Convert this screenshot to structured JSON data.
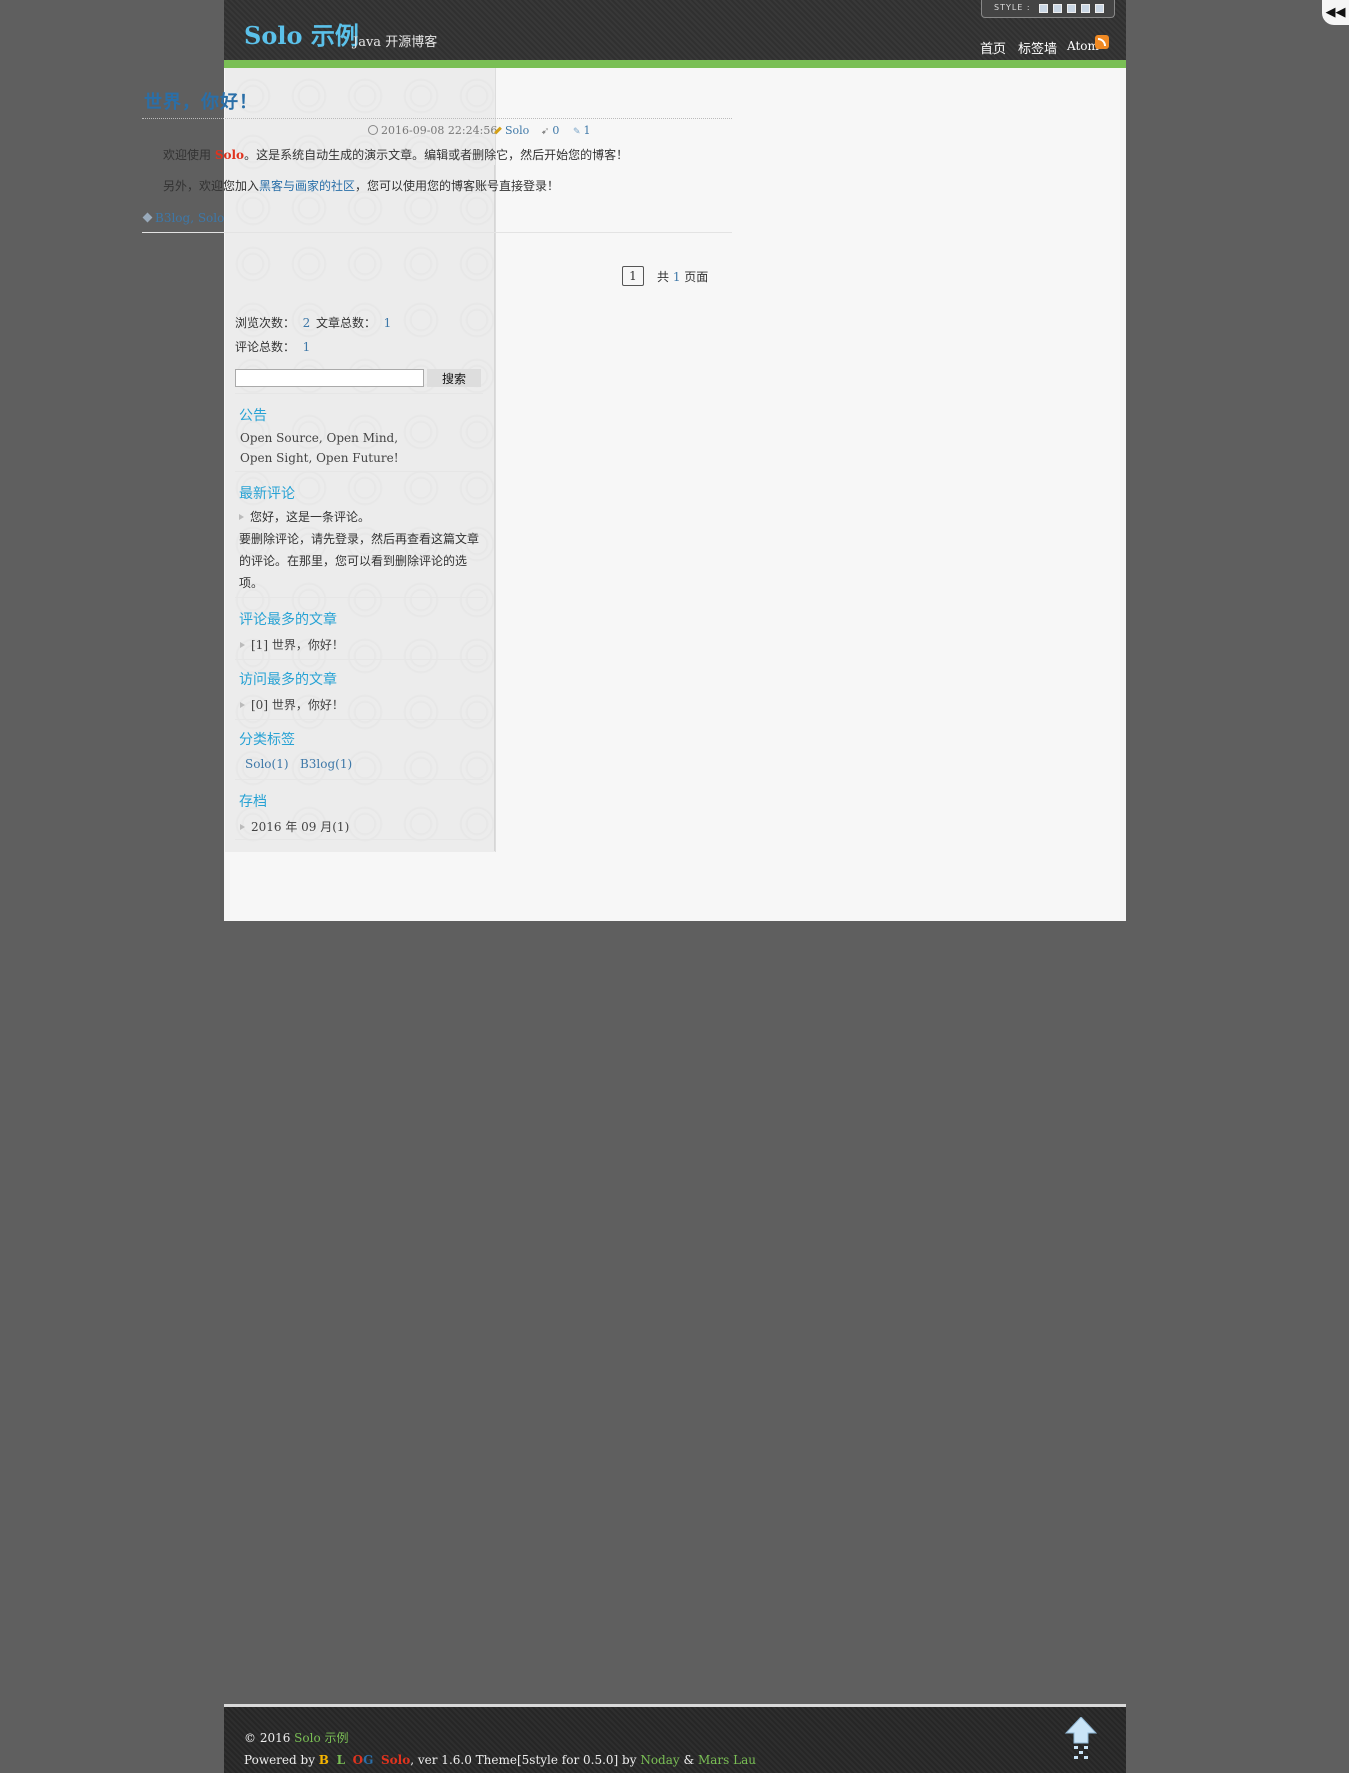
{
  "site": {
    "title": "Solo 示例",
    "subtitle": "Java 开源博客",
    "style_label": "STYLE :"
  },
  "nav": {
    "items": [
      {
        "label": "首页"
      },
      {
        "label": "标签墙"
      },
      {
        "label": "Atom"
      }
    ]
  },
  "toggle_icon": "double-chevron-left-icon",
  "post": {
    "title": "世界，你好！",
    "date": "2016-09-08 22:24:56",
    "author": "Solo",
    "views": "0",
    "comments": "1",
    "p1_a": "欢迎使用 ",
    "p1_b": "Solo",
    "p1_c": "。这是系统自动生成的演示文章。编辑或者删除它，然后开始您的博客！",
    "p2_a": "另外，欢迎您加入",
    "p2_link": "黑客与画家的社区",
    "p2_c": "，您可以使用您的博客账号直接登录！",
    "tags": "B3log, Solo"
  },
  "paging": {
    "current": "1",
    "total_prefix": "共 ",
    "total_num": "1",
    "total_suffix": " 页面"
  },
  "stats": {
    "views_label": "浏览次数：",
    "views_value": "2",
    "articles_label": "文章总数：",
    "articles_value": "1",
    "comments_label": "评论总数：",
    "comments_value": "1"
  },
  "search": {
    "button": "搜索",
    "value": ""
  },
  "notice": {
    "title": "公告",
    "line1": "Open Source, Open Mind,",
    "line2": "Open Sight, Open Future!"
  },
  "recent_comments": {
    "title": "最新评论",
    "first": "您好，这是一条评论。",
    "rest": "要删除评论，请先登录，然后再查看这篇文章的评论。在那里，您可以看到删除评论的选项。"
  },
  "most_commented": {
    "title": "评论最多的文章",
    "item": "[1] 世界，你好！"
  },
  "most_viewed": {
    "title": "访问最多的文章",
    "item": "[0] 世界，你好！"
  },
  "tag_module": {
    "title": "分类标签",
    "tags": [
      "Solo(1)",
      "B3log(1)"
    ]
  },
  "archive": {
    "title": "存档",
    "item": "2016 年 09 月(1)"
  },
  "footer": {
    "copyright": "© 2016 ",
    "site_link": "Solo 示例",
    "powered": "Powered by ",
    "b": "B",
    "l": "L",
    "o": "O",
    "g": "G",
    "solo": "Solo",
    "ver": ", ver 1.6.0   Theme[5style for 0.5.0] by ",
    "author1": "Noday",
    "amp": " & ",
    "author2": "Mars Lau"
  },
  "colors": {
    "accent_blue": "#27a2d4",
    "link_blue": "#3e78a8",
    "green": "#7abf55",
    "red": "#e0331e"
  }
}
